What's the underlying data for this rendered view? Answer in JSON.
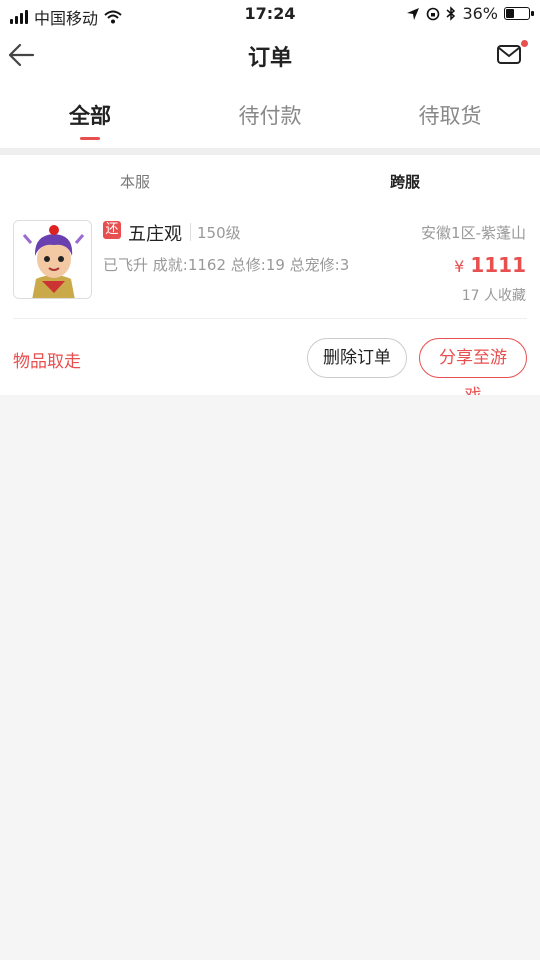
{
  "status": {
    "carrier": "中国移动",
    "time": "17:24",
    "battery": "36%"
  },
  "nav": {
    "title": "订单",
    "back_icon": "back-arrow-icon",
    "mail_icon": "mail-icon"
  },
  "tabs": [
    {
      "label": "全部",
      "active": true
    },
    {
      "label": "待付款",
      "active": false
    },
    {
      "label": "待取货",
      "active": false
    }
  ],
  "subtabs": [
    {
      "label": "本服",
      "active": false
    },
    {
      "label": "跨服",
      "active": true
    }
  ],
  "order": {
    "badge": "还",
    "name": "五庄观",
    "level": "150级",
    "server": "安徽1区-紫蓬山",
    "stats": "已飞升 成就:1162 总修:19 总宠修:3",
    "currency": "¥",
    "price": "1111",
    "favorites": "17 人收藏",
    "take_label": "物品取走",
    "delete_label": "删除订单",
    "share_label": "分享至游戏"
  },
  "colors": {
    "accent": "#e84f4f"
  }
}
